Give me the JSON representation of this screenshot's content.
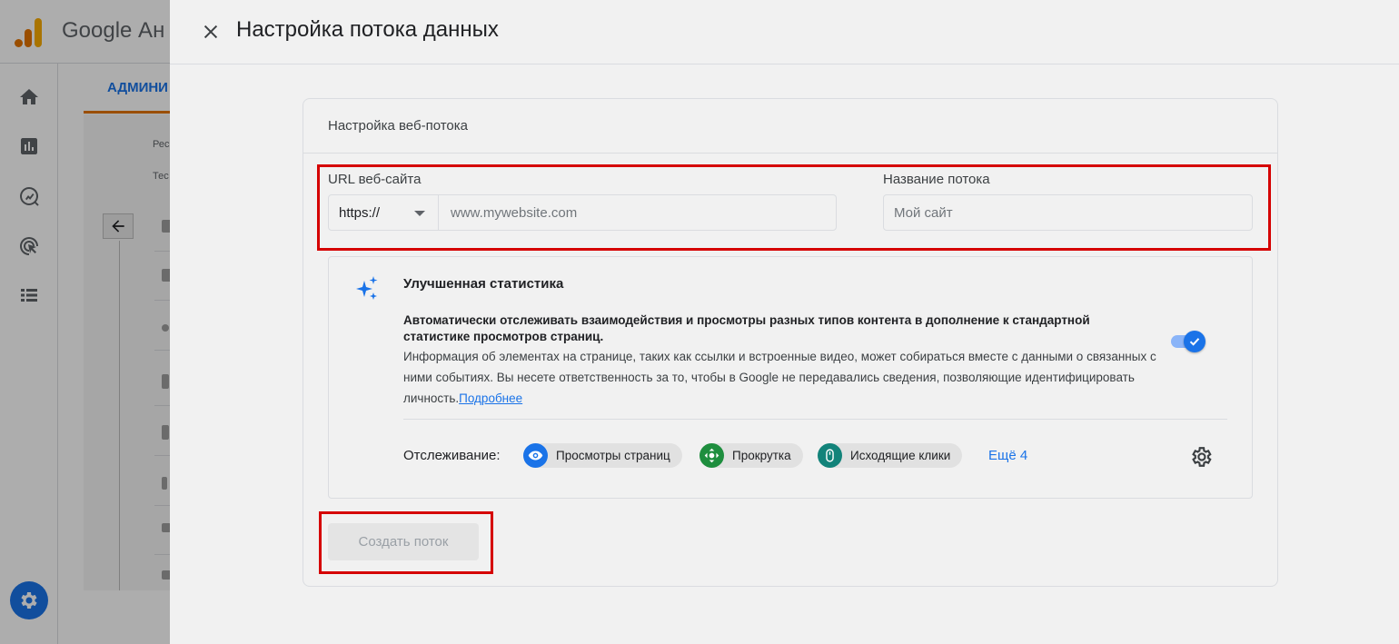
{
  "background_app": {
    "app_name": "Google Ан",
    "admin_tab": "АДМИНИ",
    "label_1": "Рес",
    "label_2": "Тес"
  },
  "dialog": {
    "title": "Настройка потока данных",
    "card_title": "Настройка веб-потока",
    "url_field": {
      "label": "URL веб-сайта",
      "protocol": "https://",
      "placeholder": "www.mywebsite.com"
    },
    "stream_name_field": {
      "label": "Название потока",
      "placeholder": "Мой сайт"
    },
    "enhanced_stats": {
      "title": "Улучшенная статистика",
      "bold_text": "Автоматически отслеживать взаимодействия и просмотры разных типов контента в дополнение к стандартной статистике просмотров страниц.",
      "info_text": "Информация об элементах на странице, таких как ссылки и встроенные видео, может собираться вместе с данными о связанных с ними событиях. Вы несете ответственность за то, чтобы в Google не передавались сведения, позволяющие идентифицировать личность.",
      "learn_more": "Подробнее",
      "enabled": true,
      "tracking_label": "Отслеживание:",
      "chips": [
        {
          "label": "Просмотры страниц",
          "icon": "eye-icon",
          "color": "#1a73e8"
        },
        {
          "label": "Прокрутка",
          "icon": "scroll-icon",
          "color": "#1e8e3e"
        },
        {
          "label": "Исходящие клики",
          "icon": "mouse-icon",
          "color": "#12837a"
        }
      ],
      "more_link": "Ещё 4"
    },
    "create_button": "Создать поток"
  },
  "colors": {
    "accent": "#1a73e8",
    "highlight_border": "#d50000"
  }
}
